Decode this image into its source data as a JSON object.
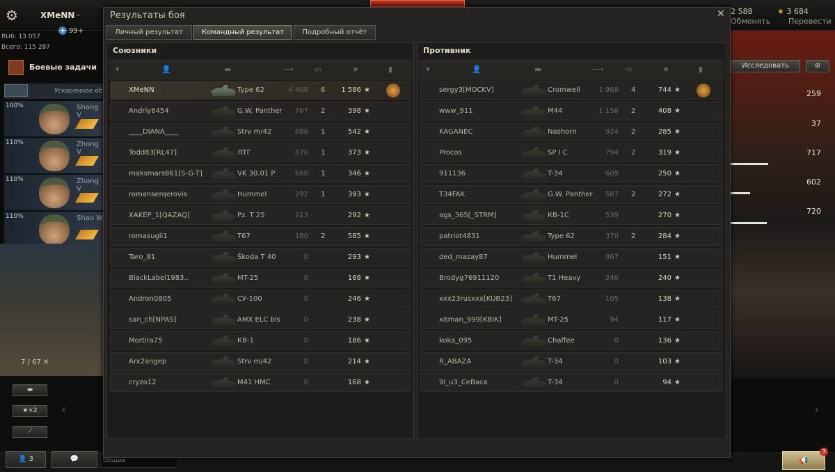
{
  "topbar": {
    "player_name": "XMeNN",
    "invite_count": "99+",
    "gold_value": "2 588",
    "gold_action": "Обменять",
    "free_xp_value": "3 684",
    "free_xp_action": "Перевести"
  },
  "left": {
    "stats_line1": "RU6: 13 057",
    "stats_line2": "Всего: 115 287",
    "tasks_label": "Боевые задачи",
    "crew_header": "Ускоренное об",
    "crew": [
      {
        "pct": "100%",
        "name": "Shang V"
      },
      {
        "pct": "110%",
        "name": "Zhong V"
      },
      {
        "pct": "110%",
        "name": "Zhong V"
      },
      {
        "pct": "110%",
        "name": "Shao W"
      }
    ],
    "carousel_counter": "7 / 67",
    "boost_label": "×2"
  },
  "bottom": {
    "friends_count": "3",
    "chat_placeholder": "Общий",
    "notify_count": "3"
  },
  "right": {
    "research_label": "Исследовать",
    "stats": [
      "259",
      "37",
      "717",
      "602",
      "720"
    ]
  },
  "dialog": {
    "title": "Результаты боя",
    "tabs": [
      "Личный результат",
      "Командный результат",
      "Подробный отчёт"
    ],
    "active_tab": 1,
    "allies_title": "Союзники",
    "enemies_title": "Противник",
    "allies": [
      {
        "name": "XMeNN",
        "tank": "Type 62",
        "dmg": "4 409",
        "kills": "6",
        "xp": "1 586",
        "medal": true,
        "me": true
      },
      {
        "name": "Andriy6454",
        "tank": "G.W. Panther",
        "dmg": "767",
        "kills": "2",
        "xp": "398"
      },
      {
        "name": "____DIANA____",
        "tank": "Strv m/42",
        "dmg": "686",
        "kills": "1",
        "xp": "542"
      },
      {
        "name": "Todd83[RL47]",
        "tank": "ЛТГ",
        "dmg": "670",
        "kills": "1",
        "xp": "373"
      },
      {
        "name": "maksmars861[S-G-T]",
        "tank": "VK 30.01 P",
        "dmg": "660",
        "kills": "1",
        "xp": "346"
      },
      {
        "name": "romanserqerovis",
        "tank": "Hummel",
        "dmg": "292",
        "kills": "1",
        "xp": "393"
      },
      {
        "name": "XAKEP_1[QAZAQ]",
        "tank": "Pz. T 25",
        "dmg": "213",
        "kills": "",
        "xp": "292"
      },
      {
        "name": "romasugli1",
        "tank": "T67",
        "dmg": "180",
        "kills": "2",
        "xp": "585"
      },
      {
        "name": "Taro_81",
        "tank": "Škoda T 40",
        "dmg": "0",
        "kills": "",
        "xp": "293"
      },
      {
        "name": "BlackLabel1983..",
        "tank": "MT-25",
        "dmg": "0",
        "kills": "",
        "xp": "168"
      },
      {
        "name": "Andron0805",
        "tank": "СУ-100",
        "dmg": "0",
        "kills": "",
        "xp": "246"
      },
      {
        "name": "san_ch[NPAS]",
        "tank": "AMX ELC bis",
        "dmg": "0",
        "kills": "",
        "xp": "238"
      },
      {
        "name": "Mortira75",
        "tank": "КВ-1",
        "dmg": "0",
        "kills": "",
        "xp": "186"
      },
      {
        "name": "Arx2angep",
        "tank": "Strv m/42",
        "dmg": "0",
        "kills": "",
        "xp": "214"
      },
      {
        "name": "cryzo12",
        "tank": "M41 HMC",
        "dmg": "0",
        "kills": "",
        "xp": "168"
      }
    ],
    "enemies": [
      {
        "name": "sergy3[MOCKV]",
        "tank": "Cromwell",
        "dmg": "1 968",
        "kills": "4",
        "xp": "744",
        "medal": true
      },
      {
        "name": "www_911",
        "tank": "M44",
        "dmg": "1 156",
        "kills": "2",
        "xp": "408"
      },
      {
        "name": "KAGANEC",
        "tank": "Nashorn",
        "dmg": "924",
        "kills": "2",
        "xp": "285"
      },
      {
        "name": "Procos",
        "tank": "SP I C",
        "dmg": "794",
        "kills": "2",
        "xp": "319",
        "cyan": true
      },
      {
        "name": "911136",
        "tank": "T-34",
        "dmg": "609",
        "kills": "",
        "xp": "250"
      },
      {
        "name": "T34FAK",
        "tank": "G.W. Panther",
        "dmg": "587",
        "kills": "2",
        "xp": "272"
      },
      {
        "name": "ags_365[_STRM]",
        "tank": "КВ-1С",
        "dmg": "539",
        "kills": "",
        "xp": "270"
      },
      {
        "name": "patriot4831",
        "tank": "Type 62",
        "dmg": "370",
        "kills": "2",
        "xp": "284"
      },
      {
        "name": "ded_mazay87",
        "tank": "Hummel",
        "dmg": "367",
        "kills": "",
        "xp": "151"
      },
      {
        "name": "Brodyg76911120",
        "tank": "T1 Heavy",
        "dmg": "240",
        "kills": "",
        "xp": "240"
      },
      {
        "name": "xxx23rusxxx[KUB23]",
        "tank": "T67",
        "dmg": "105",
        "kills": "",
        "xp": "138"
      },
      {
        "name": "xitman_999[KBIK]",
        "tank": "MT-25",
        "dmg": "94",
        "kills": "",
        "xp": "117"
      },
      {
        "name": "koka_095",
        "tank": "Chaffee",
        "dmg": "0",
        "kills": "",
        "xp": "136"
      },
      {
        "name": "R_ABAZA",
        "tank": "T-34",
        "dmg": "0",
        "kills": "",
        "xp": "103"
      },
      {
        "name": "9l_u3_CeBaca",
        "tank": "T-34",
        "dmg": "0",
        "kills": "",
        "xp": "94"
      }
    ]
  }
}
